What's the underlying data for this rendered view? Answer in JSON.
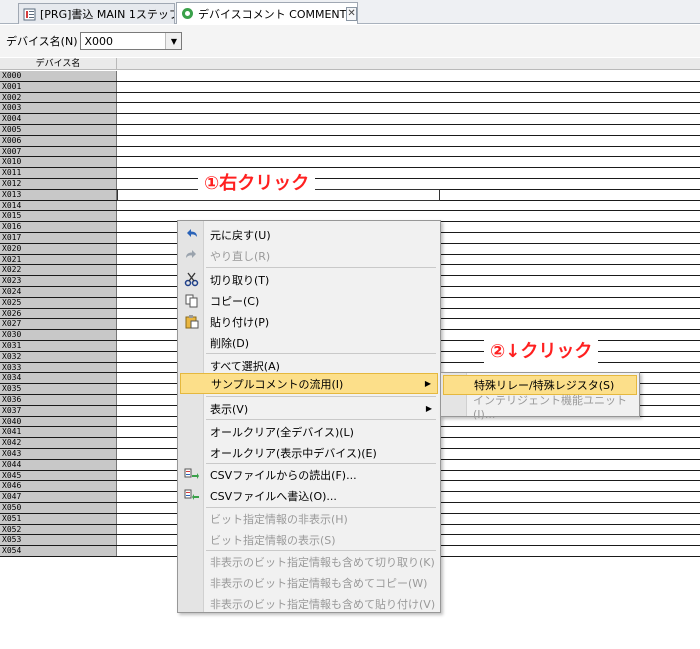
{
  "tabs": [
    {
      "label": "[PRG]書込 MAIN 1ステップ"
    },
    {
      "label": "デバイスコメント COMMENT",
      "close": "✕"
    }
  ],
  "toolbar": {
    "device_name_label": "デバイス名(N)",
    "device_value": "X000",
    "dropdown_arrow": "▼"
  },
  "grid": {
    "header_name": "デバイス名",
    "rows": [
      "X000",
      "X001",
      "X002",
      "X003",
      "X004",
      "X005",
      "X006",
      "X007",
      "X010",
      "X011",
      "X012",
      "X013",
      "X014",
      "X015",
      "X016",
      "X017",
      "X020",
      "X021",
      "X022",
      "X023",
      "X024",
      "X025",
      "X026",
      "X027",
      "X030",
      "X031",
      "X032",
      "X033",
      "X034",
      "X035",
      "X036",
      "X037",
      "X040",
      "X041",
      "X042",
      "X043",
      "X044",
      "X045",
      "X046",
      "X047",
      "X050",
      "X051",
      "X052",
      "X053",
      "X054"
    ],
    "selected_row": "X013"
  },
  "annotations": {
    "step1": "①右クリック",
    "step2": "②↓クリック",
    "color": "#ff2020"
  },
  "context_menu": {
    "items": [
      {
        "label": "元に戻す(U)",
        "icon": "undo-icon",
        "disabled": false
      },
      {
        "label": "やり直し(R)",
        "icon": "redo-icon",
        "disabled": true
      },
      {
        "label": "切り取り(T)",
        "icon": "scissors-icon",
        "disabled": false
      },
      {
        "label": "コピー(C)",
        "icon": "copy-icon",
        "disabled": false
      },
      {
        "label": "貼り付け(P)",
        "icon": "paste-icon",
        "disabled": false
      },
      {
        "label": "削除(D)",
        "disabled": false
      },
      {
        "label": "すべて選択(A)",
        "disabled": false
      },
      {
        "label": "サンプルコメントの流用(I)",
        "disabled": false,
        "highlighted": true,
        "submenu": "▶"
      },
      {
        "label": "表示(V)",
        "disabled": false,
        "submenu": "▶"
      },
      {
        "label": "オールクリア(全デバイス)(L)",
        "disabled": false
      },
      {
        "label": "オールクリア(表示中デバイス)(E)",
        "disabled": false
      },
      {
        "label": "CSVファイルからの読出(F)...",
        "icon": "csv-read-icon",
        "disabled": false
      },
      {
        "label": "CSVファイルへ書込(O)...",
        "icon": "csv-write-icon",
        "disabled": false
      },
      {
        "label": "ビット指定情報の非表示(H)",
        "disabled": true
      },
      {
        "label": "ビット指定情報の表示(S)",
        "disabled": true
      },
      {
        "label": "非表示のビット指定情報も含めて切り取り(K)",
        "disabled": true
      },
      {
        "label": "非表示のビット指定情報も含めてコピー(W)",
        "disabled": true
      },
      {
        "label": "非表示のビット指定情報も含めて貼り付け(V)",
        "disabled": true
      }
    ]
  },
  "submenu": {
    "items": [
      {
        "label": "特殊リレー/特殊レジスタ(S)",
        "highlighted": true,
        "disabled": false
      },
      {
        "label": "インテリジェント機能ユニット(I)...",
        "disabled": true
      }
    ]
  },
  "colors": {
    "highlight": "#fcdf8a",
    "row_header_bg": "#c8c8c8",
    "disabled_text": "#9a9a9a"
  }
}
